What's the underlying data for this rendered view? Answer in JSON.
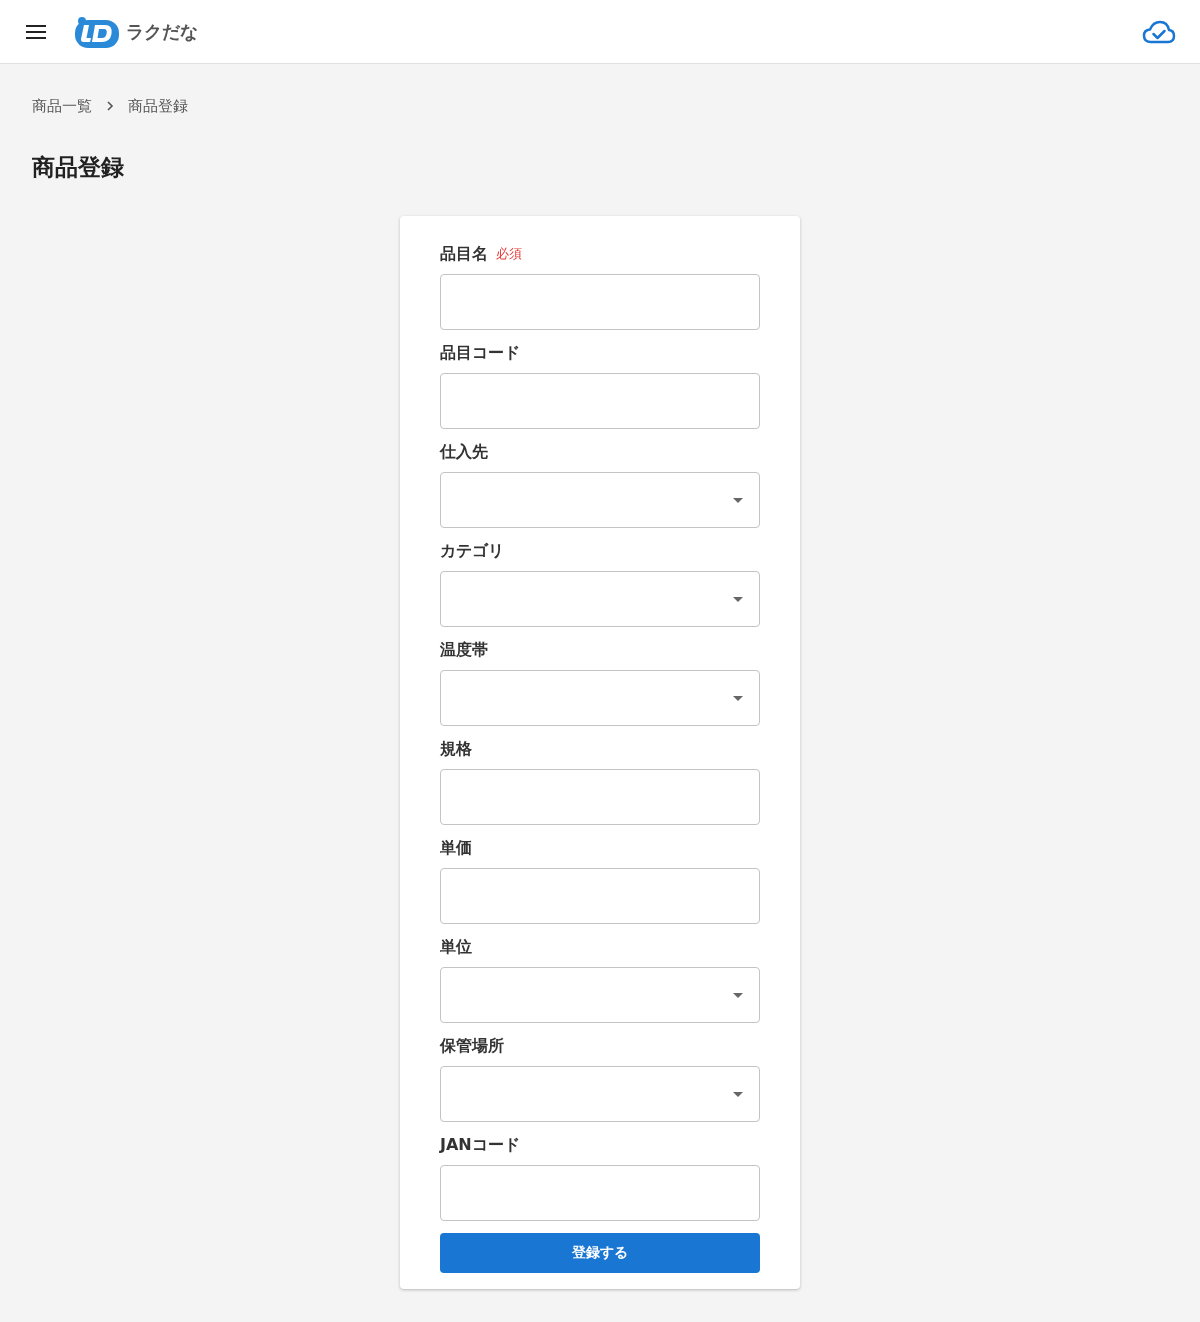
{
  "header": {
    "logo_text": "ラクだな"
  },
  "breadcrumb": [
    {
      "label": "商品一覧"
    },
    {
      "label": "商品登録"
    }
  ],
  "page_title": "商品登録",
  "form": {
    "fields": [
      {
        "label": "品目名",
        "badge": "必須",
        "kind": "text"
      },
      {
        "label": "品目コード",
        "kind": "text"
      },
      {
        "label": "仕入先",
        "kind": "select"
      },
      {
        "label": "カテゴリ",
        "kind": "select"
      },
      {
        "label": "温度帯",
        "kind": "select"
      },
      {
        "label": "規格",
        "kind": "text"
      },
      {
        "label": "単価",
        "kind": "text"
      },
      {
        "label": "単位",
        "kind": "select"
      },
      {
        "label": "保管場所",
        "kind": "select"
      },
      {
        "label": "JANコード",
        "kind": "text"
      }
    ],
    "submit": "登録する"
  }
}
